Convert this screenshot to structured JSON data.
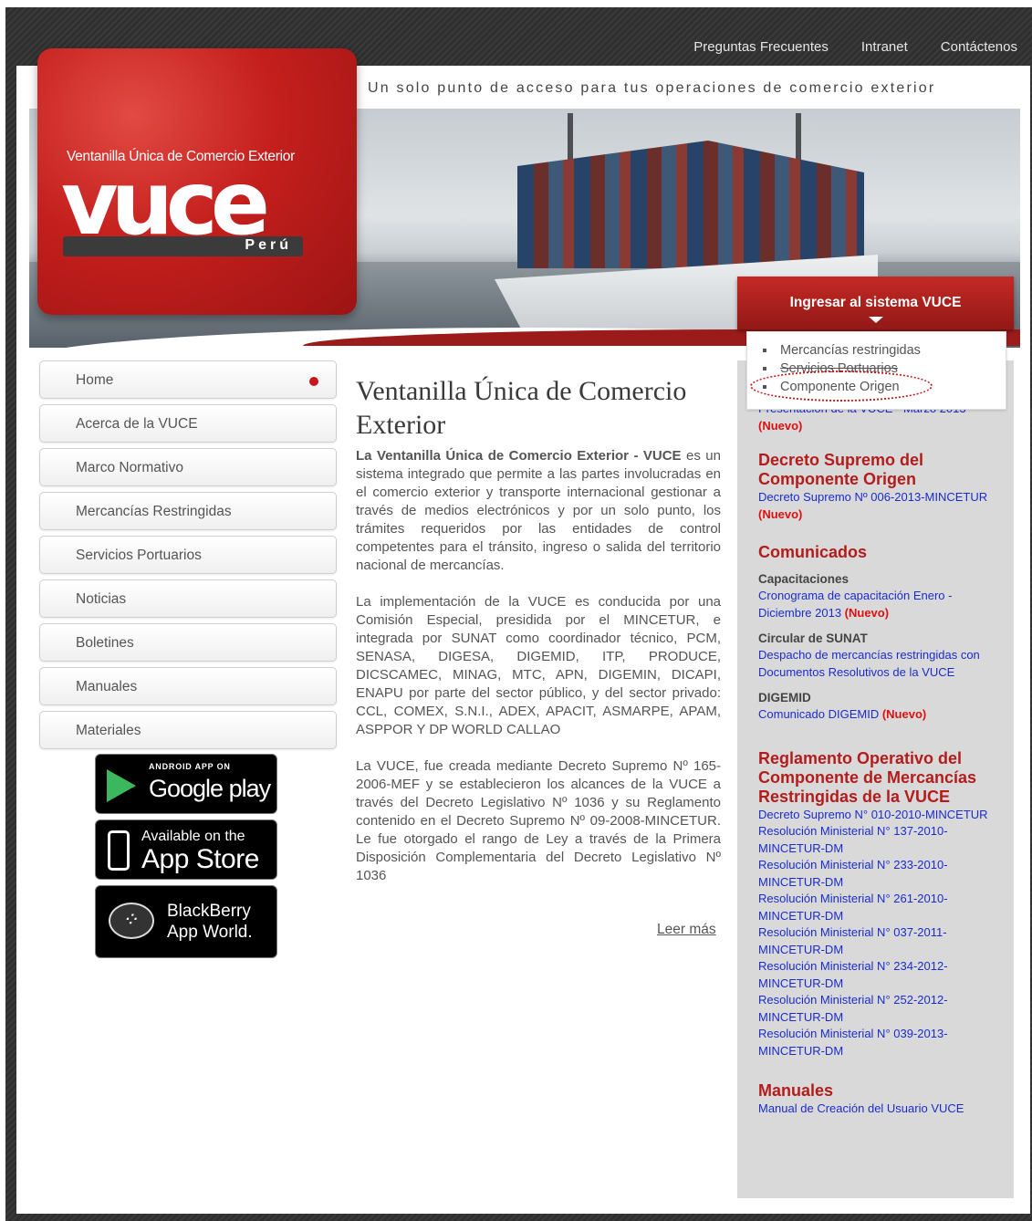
{
  "topnav": {
    "faq": "Preguntas Frecuentes",
    "intranet": "Intranet",
    "contact": "Contáctenos"
  },
  "tagline": "Un solo punto de acceso para tus operaciones de comercio exterior",
  "logo": {
    "subtitle": "Ventanilla Única de Comercio Exterior",
    "name": "VUCE",
    "country": "Perú"
  },
  "ingresar": {
    "label": "Ingresar al sistema VUCE",
    "options": [
      "Mercancías restringidas",
      "Servicios Portuarios",
      "Componente Origen"
    ]
  },
  "menu": [
    "Home",
    "Acerca de la VUCE",
    "Marco Normativo",
    "Mercancías Restringidas",
    "Servicios Portuarios",
    "Noticias",
    "Boletines",
    "Manuales",
    "Materiales"
  ],
  "badges": {
    "google": {
      "small": "ANDROID APP ON",
      "big": "Google play"
    },
    "apple": {
      "small": "Available on the",
      "big": "App Store"
    },
    "blackberry": {
      "line1": "BlackBerry",
      "line2": "App World."
    }
  },
  "main": {
    "title": "Ventanilla Única de Comercio Exterior",
    "p1_bold": "La Ventanilla Única de Comercio Exterior - VUCE",
    "p1": " es un sistema integrado que permite a las partes involucradas en el comercio exterior y transporte internacional gestionar a través de medios electrónicos y por un solo punto, los trámites requeridos por las entidades de control competentes para el tránsito, ingreso o salida del territorio nacional de mercancías.",
    "p2": "La implementación de la VUCE es conducida por una Comisión Especial, presidida por el MINCETUR, e integrada por SUNAT como coordinador técnico, PCM, SENASA, DIGESA, DIGEMID, ITP, PRODUCE, DICSCAMEC, MINAG, MTC, APN, DIGEMIN, DICAPI, ENAPU por parte del sector público, y del sector privado: CCL, COMEX, S.N.I., ADEX, APACIT, ASMARPE, APAM, ASPPOR Y DP WORLD CALLAO",
    "p3": "La VUCE, fue creada mediante Decreto Supremo Nº 165-2006-MEF y se establecieron los alcances de la VUCE a través del Decreto Legislativo Nº 1036 y su Reglamento contenido en el Decreto Supremo Nº 09-2008-MINCETUR. Le fue otorgado el rango de Ley a través de la Primera Disposición Complementaria del Decreto Legislativo Nº 1036",
    "more": "Leer más"
  },
  "side": {
    "top_link": "Presentación de la VUCE - Marzo 2013",
    "new": "(Nuevo)",
    "h_decreto": "Decreto Supremo del Componente Origen",
    "decreto_link": "Decreto Supremo Nº 006-2013-MINCETUR",
    "h_comunicados": "Comunicados",
    "cap_title": "Capacitaciones",
    "cap_link": "Cronograma de capacitación Enero - Diciembre 2013",
    "sunat_title": "Circular de SUNAT",
    "sunat_link": "Despacho de mercancías restringidas con Documentos Resolutivos de la VUCE",
    "digemid_title": "DIGEMID",
    "digemid_link": "Comunicado DIGEMID",
    "h_reglamento": "Reglamento Operativo del Componente de Mercancías Restringidas de la VUCE",
    "reglamento_links": [
      "Decreto Supremo N° 010-2010-MINCETUR",
      "Resolución Ministerial N° 137-2010-MINCETUR-DM",
      "Resolución Ministerial N° 233-2010-MINCETUR-DM",
      "Resolución Ministerial N° 261-2010-MINCETUR-DM",
      "Resolución Ministerial N° 037-2011-MINCETUR-DM",
      "Resolución Ministerial N° 234-2012-MINCETUR-DM",
      "Resolución Ministerial N° 252-2012-MINCETUR-DM",
      "Resolución Ministerial N° 039-2013-MINCETUR-DM"
    ],
    "h_manuales": "Manuales",
    "manual_link": "Manual de Creación del Usuario VUCE"
  },
  "colors": {
    "brand_red": "#c41f1d",
    "link_blue": "#1b2ccc",
    "new_red": "#dd1111"
  }
}
